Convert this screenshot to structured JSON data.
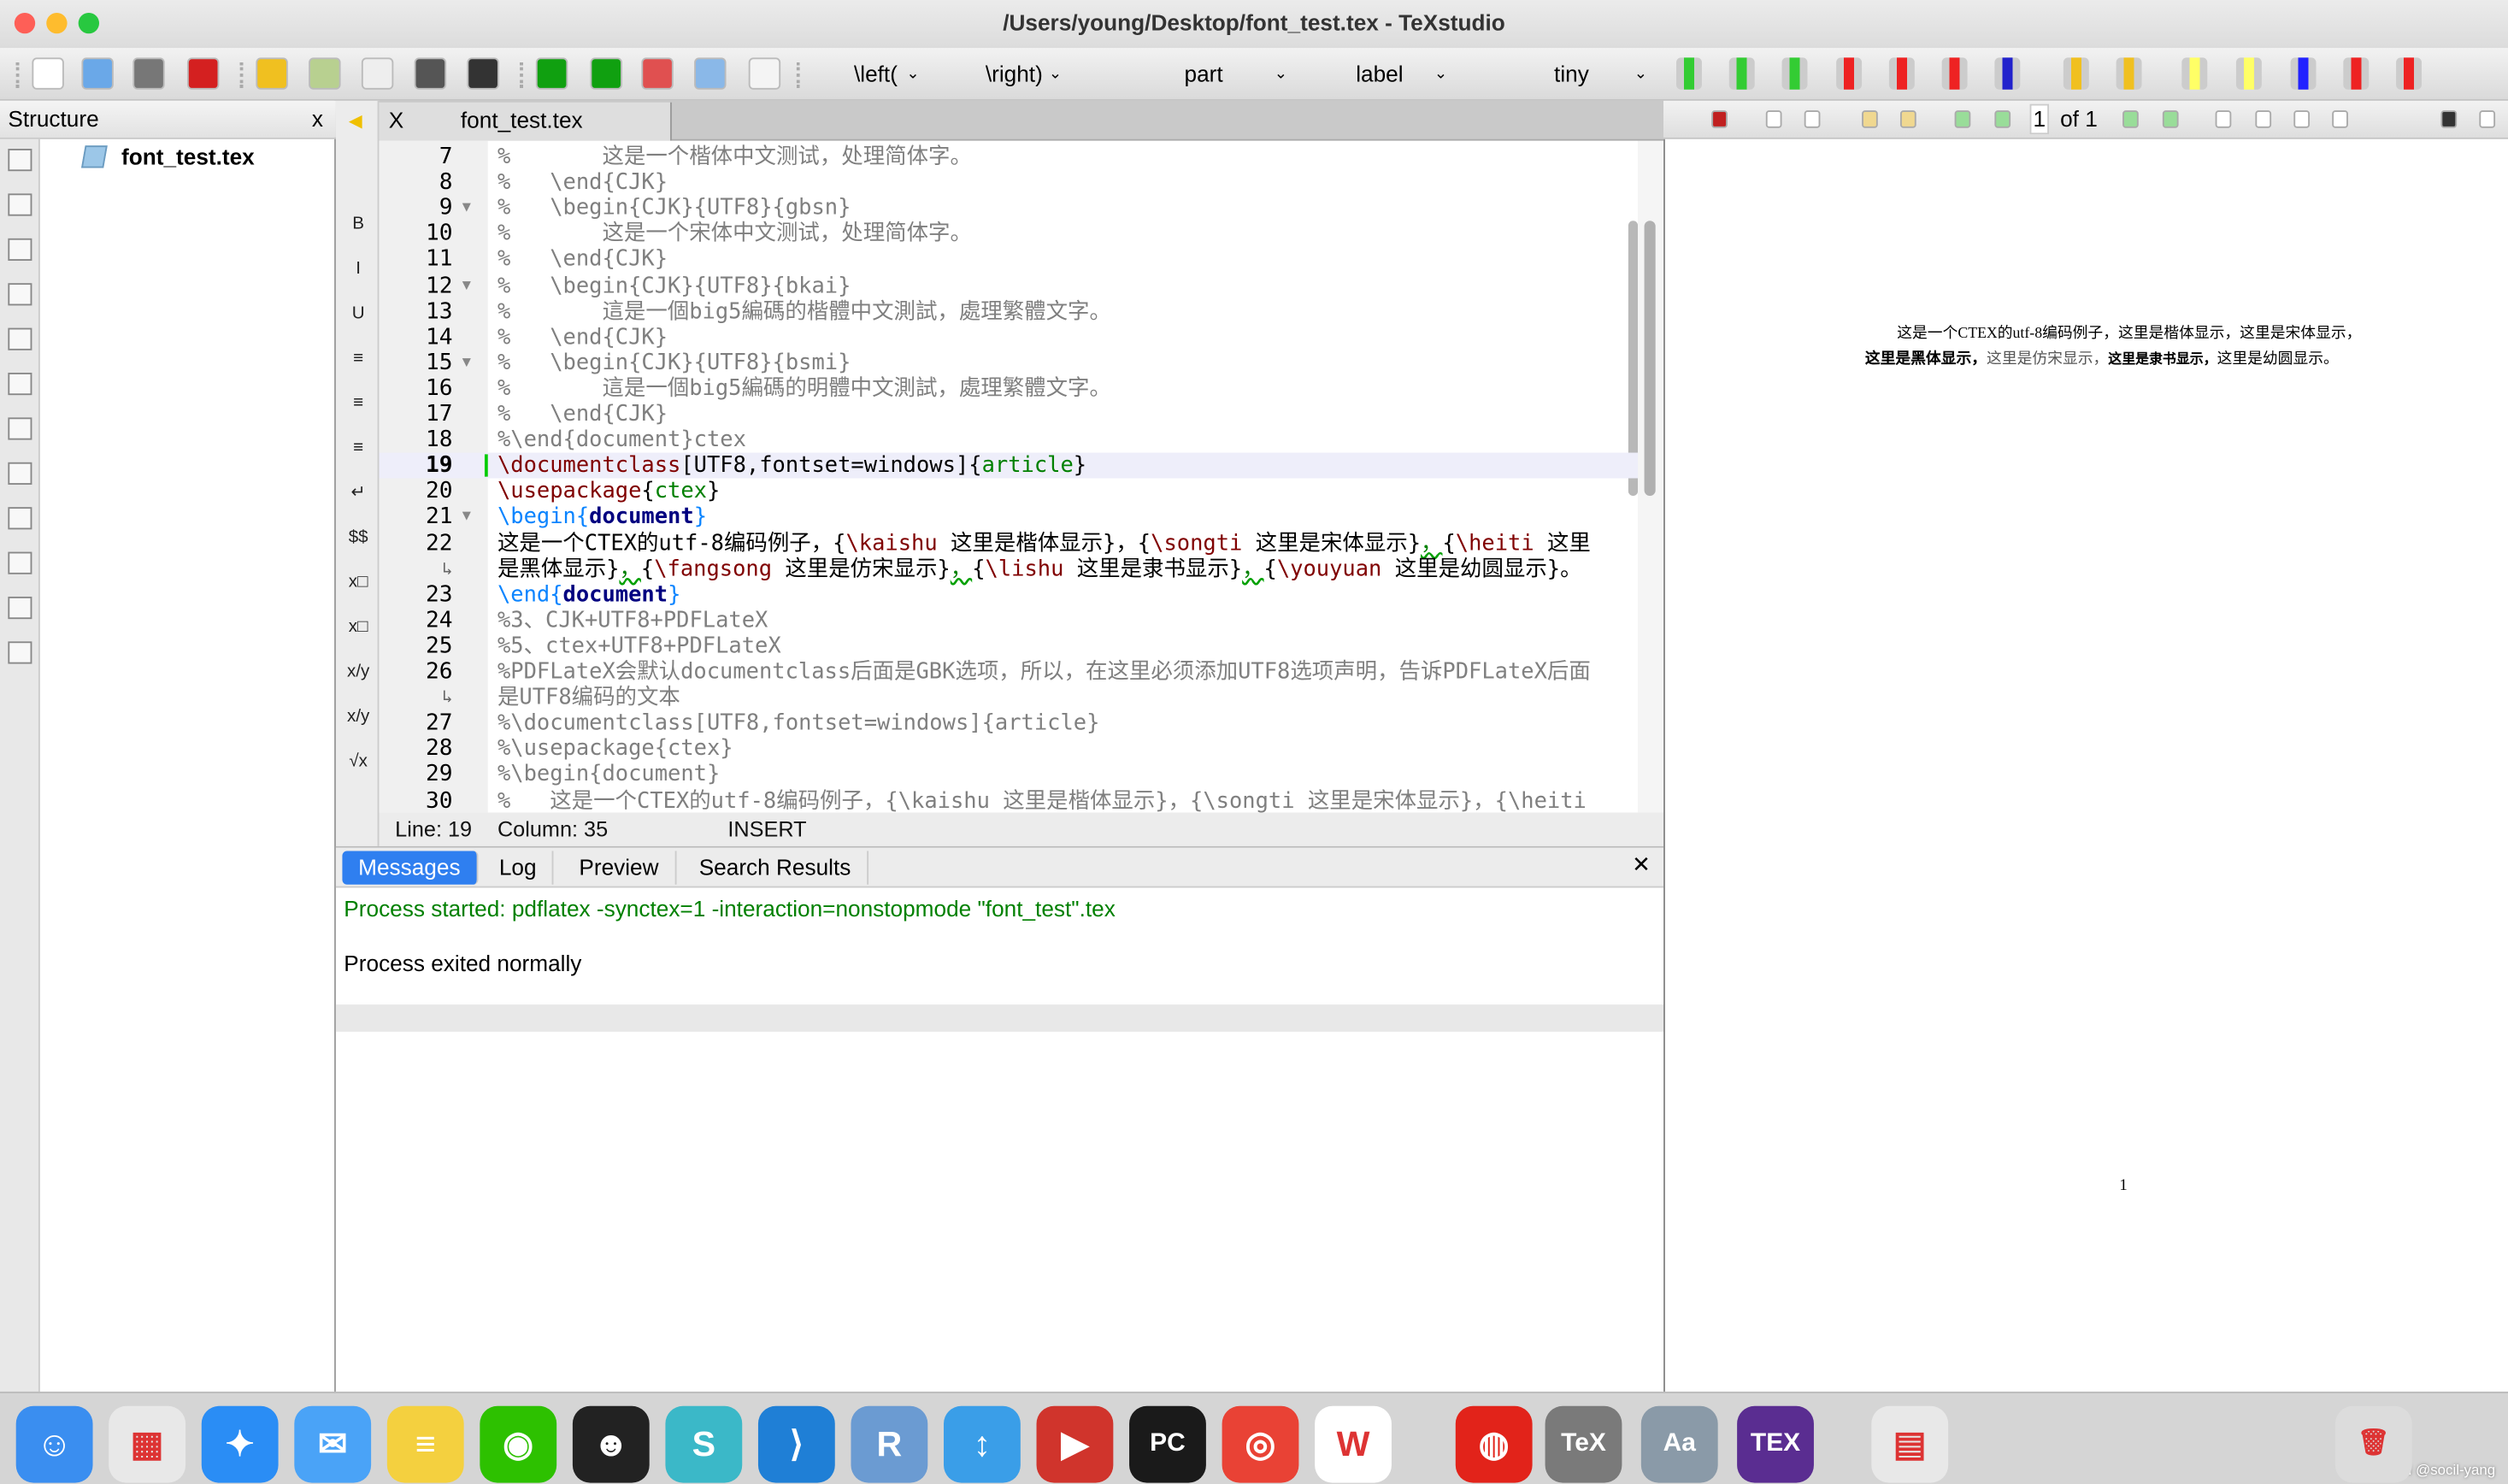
{
  "window": {
    "title": "/Users/young/Desktop/font_test.tex - TeXstudio"
  },
  "colors": {
    "accent": "#2f7ff0",
    "process_started": "#008000",
    "comment": "#7f7f7f",
    "command": "#800000",
    "argument": "#008000"
  },
  "toolbar": {
    "icons": [
      "new-file-icon",
      "print-icon",
      "save-icon",
      "close-file-icon",
      "undo-icon",
      "redo-icon",
      "copy-icon",
      "cut-icon",
      "paste-icon",
      "build-and-view-icon",
      "compile-icon",
      "stop-icon",
      "view-pdf-icon",
      "view-log-icon"
    ],
    "dropdowns": [
      "\\left(",
      "\\right)",
      "part",
      "label",
      "tiny"
    ],
    "table_icons": [
      "add-row-icon",
      "add-column-icon",
      "insert-column-icon",
      "remove-row-icon",
      "remove-column-icon",
      "cut-column-icon",
      "align-columns-icon",
      "previous-mark-icon",
      "next-mark-icon",
      "highlight-icon",
      "comment-icon",
      "text-color-icon",
      "strikethrough-icon",
      "move-text-icon"
    ]
  },
  "structure": {
    "title": "Structure",
    "close": "x",
    "tree_item": "font_test.tex",
    "side_icons": [
      "structure-icon",
      "list-icon",
      "bookmark-icon",
      "asterisk-icon",
      "brackets-icon",
      "ps-icon",
      "mp-icon",
      "ti-icon",
      "as-icon",
      "bm-icon",
      "xy-icon",
      "symbols-icon"
    ]
  },
  "editor": {
    "tab": {
      "label": "font_test.tex",
      "close": "X"
    },
    "side_icons": [
      "B",
      "I",
      "U",
      "≡",
      "≡",
      "≡",
      "↵",
      "$$",
      "x□",
      "x□",
      "x/y",
      "x/y",
      "√x"
    ],
    "rows": [
      {
        "n": "7",
        "s": [
          [
            "%       这是一个楷体中文测试，处理简体字。",
            "com"
          ]
        ]
      },
      {
        "n": "8",
        "s": [
          [
            "%   \\end{CJK}",
            "com"
          ]
        ]
      },
      {
        "n": "9",
        "f": 1,
        "s": [
          [
            "%   \\begin{CJK}{UTF8}{gbsn}",
            "com"
          ]
        ]
      },
      {
        "n": "10",
        "s": [
          [
            "%       这是一个宋体中文测试，处理简体字。",
            "com"
          ]
        ]
      },
      {
        "n": "11",
        "s": [
          [
            "%   \\end{CJK}",
            "com"
          ]
        ]
      },
      {
        "n": "12",
        "f": 1,
        "s": [
          [
            "%   \\begin{CJK}{UTF8}{bkai}",
            "com"
          ]
        ]
      },
      {
        "n": "13",
        "s": [
          [
            "%       這是一個big5編碼的楷體中文測試，處理繁體文字。",
            "com"
          ]
        ]
      },
      {
        "n": "14",
        "s": [
          [
            "%   \\end{CJK}",
            "com"
          ]
        ]
      },
      {
        "n": "15",
        "f": 1,
        "s": [
          [
            "%   \\begin{CJK}{UTF8}{bsmi}",
            "com"
          ]
        ]
      },
      {
        "n": "16",
        "s": [
          [
            "%       這是一個big5編碼的明體中文測試，處理繁體文字。",
            "com"
          ]
        ]
      },
      {
        "n": "17",
        "s": [
          [
            "%   \\end{CJK}",
            "com"
          ]
        ]
      },
      {
        "n": "18",
        "s": [
          [
            "%\\end{document}ctex",
            "com"
          ]
        ]
      },
      {
        "n": "19",
        "hl": 1,
        "s": [
          [
            "\\documentclass",
            "cmd"
          ],
          [
            "[UTF8,fontset=windows]{",
            "txt"
          ],
          [
            "article",
            "arg"
          ],
          [
            "}",
            "txt"
          ]
        ]
      },
      {
        "n": "20",
        "s": [
          [
            "\\usepackage",
            "cmd"
          ],
          [
            "{",
            "txt"
          ],
          [
            "ctex",
            "arg"
          ],
          [
            "}",
            "txt"
          ]
        ]
      },
      {
        "n": "21",
        "f": 1,
        "s": [
          [
            "\\begin",
            "beg"
          ],
          [
            "{",
            "beg"
          ],
          [
            "document",
            "env"
          ],
          [
            "}",
            "beg"
          ]
        ]
      },
      {
        "n": "22",
        "s": [
          [
            "这是一个CTEX的utf-8编码例子，{",
            "txt"
          ],
          [
            "\\kaishu",
            "cmd"
          ],
          [
            " 这里是楷体显示}，{",
            "txt"
          ],
          [
            "\\songti",
            "cmd"
          ],
          [
            " 这里是宋体显示}",
            "txt"
          ],
          [
            "，",
            "sq"
          ],
          [
            "{",
            "txt"
          ],
          [
            "\\heiti",
            "cmd"
          ],
          [
            " 这里",
            "txt"
          ]
        ]
      },
      {
        "n": "↳",
        "s": [
          [
            "是黑体显示}",
            "txt"
          ],
          [
            "，",
            "sq"
          ],
          [
            "{",
            "txt"
          ],
          [
            "\\fangsong",
            "cmd"
          ],
          [
            " 这里是仿宋显示}",
            "txt"
          ],
          [
            "，",
            "sq"
          ],
          [
            "{",
            "txt"
          ],
          [
            "\\lishu",
            "cmd"
          ],
          [
            " 这里是隶书显示}",
            "txt"
          ],
          [
            "，",
            "sq"
          ],
          [
            "{",
            "txt"
          ],
          [
            "\\youyuan",
            "cmd"
          ],
          [
            " 这里是幼圆显示}。",
            "txt"
          ]
        ]
      },
      {
        "n": "23",
        "s": [
          [
            "\\end",
            "beg"
          ],
          [
            "{",
            "beg"
          ],
          [
            "document",
            "env"
          ],
          [
            "}",
            "beg"
          ]
        ]
      },
      {
        "n": "24",
        "s": [
          [
            "%3、CJK+UTF8+PDFLateX",
            "com"
          ]
        ]
      },
      {
        "n": "25",
        "s": [
          [
            "%5、ctex+UTF8+PDFLateX",
            "com"
          ]
        ]
      },
      {
        "n": "26",
        "s": [
          [
            "%PDFLateX会默认documentclass后面是GBK选项，所以，在这里必须添加UTF8选项声明，告诉PDFLateX后面",
            "com"
          ]
        ]
      },
      {
        "n": "↳",
        "s": [
          [
            "是UTF8编码的文本",
            "com"
          ]
        ]
      },
      {
        "n": "27",
        "s": [
          [
            "%\\documentclass[UTF8,fontset=windows]{article}",
            "com"
          ]
        ]
      },
      {
        "n": "28",
        "s": [
          [
            "%\\usepackage{ctex}",
            "com"
          ]
        ]
      },
      {
        "n": "29",
        "s": [
          [
            "%\\begin{document}",
            "com"
          ]
        ]
      },
      {
        "n": "30",
        "s": [
          [
            "%   这是一个CTEX的utf-8编码例子，{\\kaishu 这里是楷体显示}，{\\songti 这里是宋体显示}，{\\heiti",
            "com"
          ]
        ]
      }
    ],
    "status": {
      "line": "Line: 19",
      "column": "Column: 35",
      "mode": "INSERT"
    }
  },
  "messages": {
    "tabs": [
      "Messages",
      "Log",
      "Preview",
      "Search Results"
    ],
    "active_tab": "Messages",
    "close": "✕",
    "process_started": "Process started: pdflatex -synctex=1 -interaction=nonstopmode \"font_test\".tex",
    "process_exited": "Process exited normally"
  },
  "pdf": {
    "page_input": "1",
    "of_label": "of 1",
    "icons": [
      "external-viewer-icon",
      "magnifier-icon",
      "hand-icon",
      "back-icon",
      "forward-icon",
      "first-page-icon",
      "previous-page-icon",
      "next-page-icon",
      "last-page-icon",
      "zoom-100-icon",
      "fit-width-icon",
      "fit-page-icon",
      "fit-text-icon",
      "minimize-icon",
      "dock-icon"
    ],
    "line1": "这是一个CTEX的utf-8编码例子，这里是楷体显示，这里是宋体显示，",
    "line2": [
      "这里是黑体显示，",
      "这里是仿宋显示，",
      "这里是隶书显示，",
      "这里是幼圆显示。"
    ],
    "page_number": "1"
  },
  "dock": {
    "apps": [
      {
        "name": "finder",
        "glyph": "☺",
        "color": "#3a8ef0"
      },
      {
        "name": "launchpad",
        "glyph": "▦",
        "color": "#e8e8e8"
      },
      {
        "name": "safari",
        "glyph": "✦",
        "color": "#2a8df5"
      },
      {
        "name": "mail",
        "glyph": "✉",
        "color": "#4aa3f7"
      },
      {
        "name": "notes",
        "glyph": "≡",
        "color": "#f4d03f"
      },
      {
        "name": "wechat",
        "glyph": "◉",
        "color": "#2dc100"
      },
      {
        "name": "qq",
        "glyph": "☻",
        "color": "#222222"
      },
      {
        "name": "sublime",
        "glyph": "S",
        "color": "#3bb8c8"
      },
      {
        "name": "vscode",
        "glyph": "⟩",
        "color": "#1f7fd6"
      },
      {
        "name": "r",
        "glyph": "R",
        "color": "#6b9bd2"
      },
      {
        "name": "transfer",
        "glyph": "↕",
        "color": "#3a9ee8"
      },
      {
        "name": "parallels",
        "glyph": "▶",
        "color": "#d0342c"
      },
      {
        "name": "pycharm",
        "glyph": "PC",
        "color": "#1a1a1a"
      },
      {
        "name": "chrome",
        "glyph": "◎",
        "color": "#e94235"
      },
      {
        "name": "wps",
        "glyph": "W",
        "color": "#ffffff"
      },
      {
        "name": "netease-music",
        "glyph": "◍",
        "color": "#e2231a"
      },
      {
        "name": "tex-shop",
        "glyph": "TeX",
        "color": "#7a7a7a"
      },
      {
        "name": "font-book",
        "glyph": "Aa",
        "color": "#8a9aa8"
      },
      {
        "name": "texstudio",
        "glyph": "TEX",
        "color": "#5a2d91"
      },
      {
        "name": "disk-utility",
        "glyph": "▤",
        "color": "#e8e8e8"
      },
      {
        "name": "trash",
        "glyph": "🗑",
        "color": "#dcdcdc"
      }
    ],
    "watermark": "CSDN @socil-yang"
  }
}
